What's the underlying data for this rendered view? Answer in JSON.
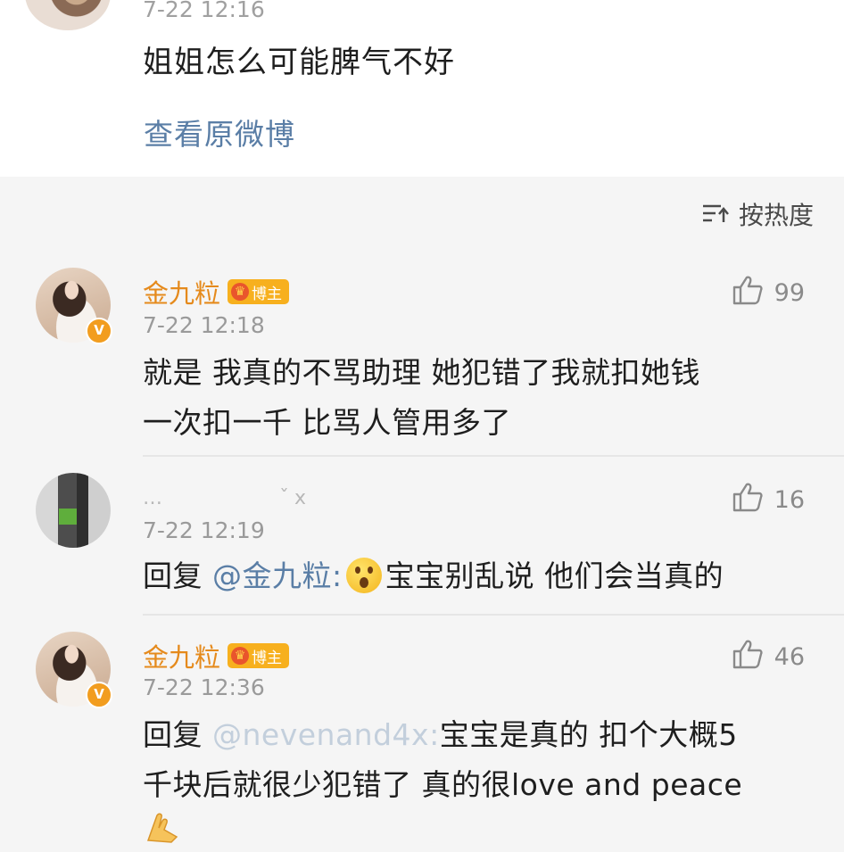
{
  "post": {
    "time": "7-22 12:16",
    "content": "姐姐怎么可能脾气不好",
    "view_original": "查看原微博"
  },
  "sort": {
    "label": "按热度"
  },
  "comments": [
    {
      "name": "金九粒",
      "badge": "博主",
      "verified": "V",
      "time": "7-22 12:18",
      "likes": "99",
      "text_line1": "就是 我真的不骂助理 她犯错了我就扣她钱",
      "text_line2": "一次扣一千 比骂人管用多了"
    },
    {
      "name": "…　　　　 ˇx",
      "time": "7-22 12:19",
      "likes": "16",
      "reply_prefix": "回复",
      "mention": "@金九粒:",
      "emoji": "shocked-face",
      "text": "宝宝别乱说 他们会当真的"
    },
    {
      "name": "金九粒",
      "badge": "博主",
      "verified": "V",
      "time": "7-22 12:36",
      "likes": "46",
      "reply_prefix": "回复",
      "mention": "@nevenand4x:",
      "text_line1": "宝宝是真的 扣个大概5",
      "text_line2": "千块后就很少犯错了 真的很love and peace",
      "emoji": "praying-hands"
    }
  ],
  "colors": {
    "username": "#e58a1c",
    "link": "#5a7ea6",
    "time": "#9a9a9a",
    "badge": "#f7b01e"
  }
}
